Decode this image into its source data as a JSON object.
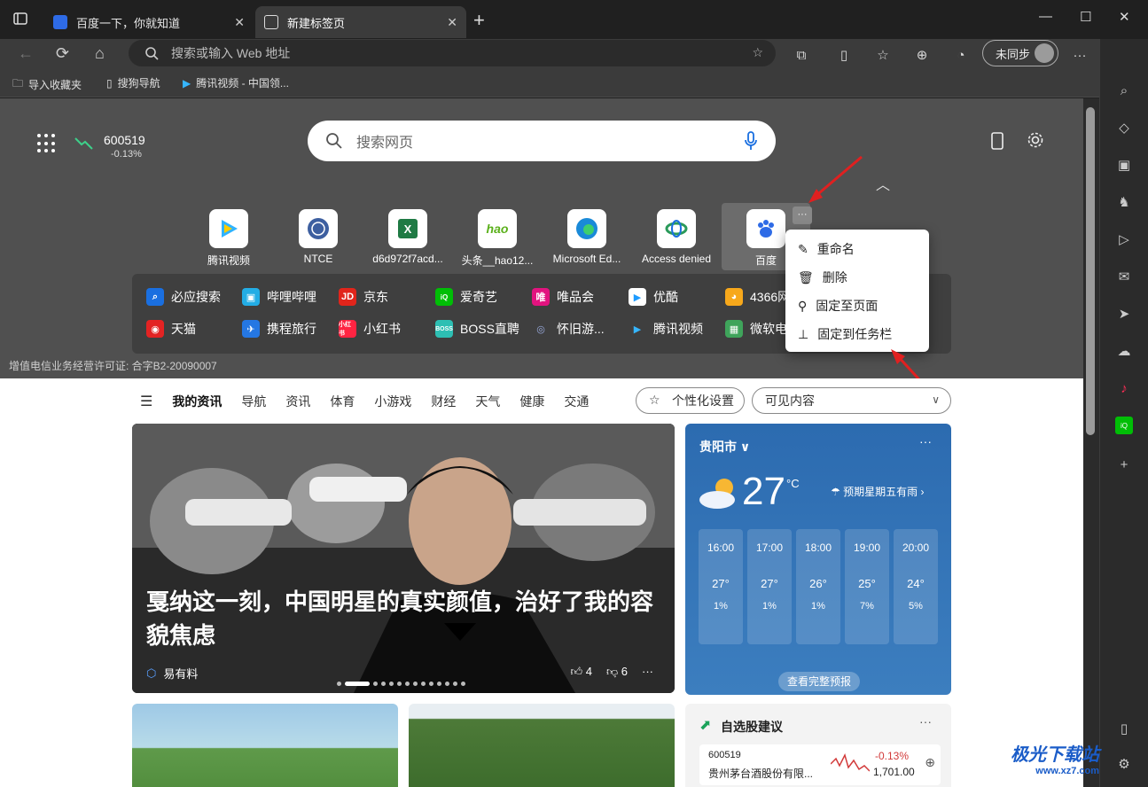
{
  "tabs": [
    {
      "title": "百度一下，你就知道"
    },
    {
      "title": "新建标签页"
    }
  ],
  "address": {
    "placeholder": "搜索或输入 Web 地址"
  },
  "profile": {
    "label": "未同步"
  },
  "bookmarks": [
    {
      "label": "导入收藏夹"
    },
    {
      "label": "搜狗导航"
    },
    {
      "label": "腾讯视频 - 中国领..."
    }
  ],
  "stock": {
    "code": "600519",
    "change": "-0.13%"
  },
  "search": {
    "placeholder": "搜索网页"
  },
  "tiles": [
    {
      "label": "腾讯视频",
      "color": "#2fb3ff"
    },
    {
      "label": "NTCE",
      "color": "#3d5fa0"
    },
    {
      "label": "d6d972f7acd...",
      "color": "#1f7a44"
    },
    {
      "label": "头条__hao12...",
      "color": "#5ab01a"
    },
    {
      "label": "Microsoft Ed...",
      "color": "#1a8ad8"
    },
    {
      "label": "Access denied",
      "color": "#2a9a5a"
    },
    {
      "label": "百度",
      "color": "#2e6be6"
    }
  ],
  "links_row1": [
    "必应搜索",
    "哔哩哔哩",
    "京东",
    "爱奇艺",
    "唯品会",
    "优酷",
    "4366网"
  ],
  "links_row2": [
    "天猫",
    "携程旅行",
    "小红书",
    "BOSS直聘",
    "怀旧游...",
    "腾讯视频",
    "微软电"
  ],
  "license": "增值电信业务经营许可证: 合字B2-20090007",
  "context_menu": [
    "重命名",
    "删除",
    "固定至页面",
    "固定到任务栏"
  ],
  "feed": {
    "tabs": [
      "我的资讯",
      "导航",
      "资讯",
      "体育",
      "小游戏",
      "财经",
      "天气",
      "健康",
      "交通"
    ],
    "personalize": "个性化设置",
    "visible": "可见内容",
    "hero": {
      "title": "戛纳这一刻，中国明星的真实颜值，治好了我的容貌焦虑",
      "source": "易有料",
      "likes": "4",
      "dislikes": "6"
    }
  },
  "weather": {
    "city": "贵阳市",
    "temp": "27",
    "unit": "°C",
    "note": "预期星期五有雨",
    "hours": [
      {
        "time": "16:00",
        "temp": "27°",
        "precip": "1%"
      },
      {
        "time": "17:00",
        "temp": "27°",
        "precip": "1%"
      },
      {
        "time": "18:00",
        "temp": "26°",
        "precip": "1%"
      },
      {
        "time": "19:00",
        "temp": "25°",
        "precip": "7%"
      },
      {
        "time": "20:00",
        "temp": "24°",
        "precip": "5%"
      }
    ],
    "full": "查看完整预报"
  },
  "stock_card": {
    "title": "自选股建议",
    "code": "600519",
    "name": "贵州茅台酒股份有限...",
    "change": "-0.13%",
    "price": "1,701.00"
  },
  "watermark": {
    "title": "极光下载站",
    "url": "www.xz7.com"
  }
}
